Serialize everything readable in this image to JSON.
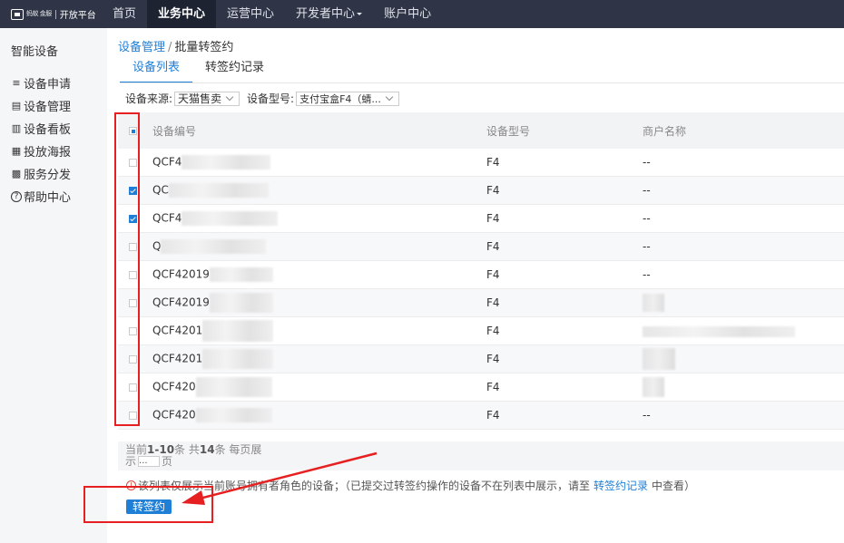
{
  "brand": {
    "mark": "蚂蚁 金服",
    "name": "开放平台"
  },
  "nav": [
    {
      "label": "首页"
    },
    {
      "label": "业务中心"
    },
    {
      "label": "运营中心"
    },
    {
      "label": "开发者中心"
    },
    {
      "label": "账户中心"
    }
  ],
  "sidebar": {
    "title": "智能设备",
    "items": [
      {
        "label": "设备申请",
        "icon": "≡"
      },
      {
        "label": "设备管理",
        "icon": "▤"
      },
      {
        "label": "设备看板",
        "icon": "▥"
      },
      {
        "label": "投放海报",
        "icon": "▦"
      },
      {
        "label": "服务分发",
        "icon": "▩"
      },
      {
        "label": "帮助中心",
        "icon": "?"
      }
    ]
  },
  "breadcrumb": {
    "parent": "设备管理",
    "sep": "/",
    "current": "批量转签约"
  },
  "tabs": [
    {
      "label": "设备列表"
    },
    {
      "label": "转签约记录"
    }
  ],
  "filters": {
    "source_label": "设备来源:",
    "source_value": "天猫售卖",
    "model_label": "设备型号:",
    "model_value": "支付宝盒F4（蜻..."
  },
  "table": {
    "headers": {
      "id": "设备编号",
      "model": "设备型号",
      "merchant": "商户名称"
    },
    "rows": [
      {
        "id": "QCF4",
        "model": "F4",
        "merchant": "--",
        "checked": false
      },
      {
        "id": "QC",
        "model": "F4",
        "merchant": "--",
        "checked": true
      },
      {
        "id": "QCF4",
        "model": "F4",
        "merchant": "--",
        "checked": true
      },
      {
        "id": "Q",
        "model": "F4",
        "merchant": "--",
        "checked": false
      },
      {
        "id": "QCF42019",
        "model": "F4",
        "merchant": "--",
        "checked": false
      },
      {
        "id": "QCF42019",
        "model": "F4",
        "merchant": "",
        "checked": false
      },
      {
        "id": "QCF4201",
        "model": "F4",
        "merchant": "",
        "checked": false
      },
      {
        "id": "QCF4201",
        "model": "F4",
        "merchant": "",
        "checked": false
      },
      {
        "id": "QCF420",
        "model": "F4",
        "merchant": "",
        "checked": false
      },
      {
        "id": "QCF420",
        "model": "F4",
        "merchant": "--",
        "checked": false
      }
    ]
  },
  "pager": {
    "prefix": "当前",
    "range": "1-10",
    "mid1": "条 共",
    "total": "14",
    "mid2": "条 每页展",
    "line2_prefix": "示",
    "page_size": "...",
    "suffix": "页"
  },
  "notice": {
    "icon": "!",
    "text_before": "该列表仅展示当前账号拥有者角色的设备；（已提交过转签约操作的设备不在列表中展示，请至",
    "link": "转签约记录",
    "text_after": "中查看）"
  },
  "primary_button": "转签约",
  "colors": {
    "primary": "#1f7fd7",
    "nav_bg": "#2f3546",
    "annotation": "#e62020"
  }
}
